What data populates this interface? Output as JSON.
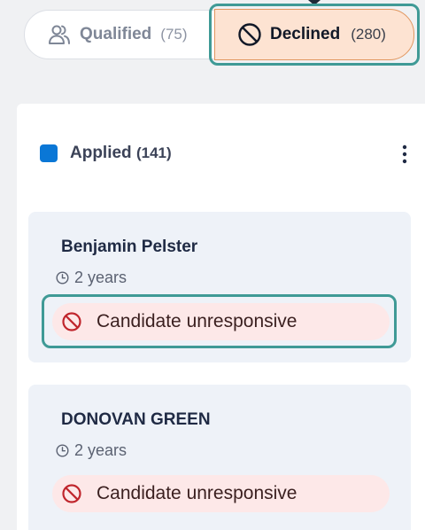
{
  "tabs": {
    "qualified": {
      "label": "Qualified",
      "count": "(75)",
      "icon": "users-icon"
    },
    "declined": {
      "label": "Declined",
      "count": "(280)",
      "icon": "ban-icon"
    }
  },
  "column": {
    "title": "Applied",
    "count": "(141)",
    "color": "#0a77d6"
  },
  "candidates": [
    {
      "name": "Benjamin Pelster",
      "tenure": "2 years",
      "reason": "Candidate unresponsive"
    },
    {
      "name": "DONOVAN GREEN",
      "tenure": "2 years",
      "reason": "Candidate unresponsive"
    }
  ],
  "colors": {
    "highlight": "#3f9a96",
    "declined_bg": "#fde3d2",
    "reason_bg": "#fde8e8",
    "reason_icon": "#c0262d"
  }
}
